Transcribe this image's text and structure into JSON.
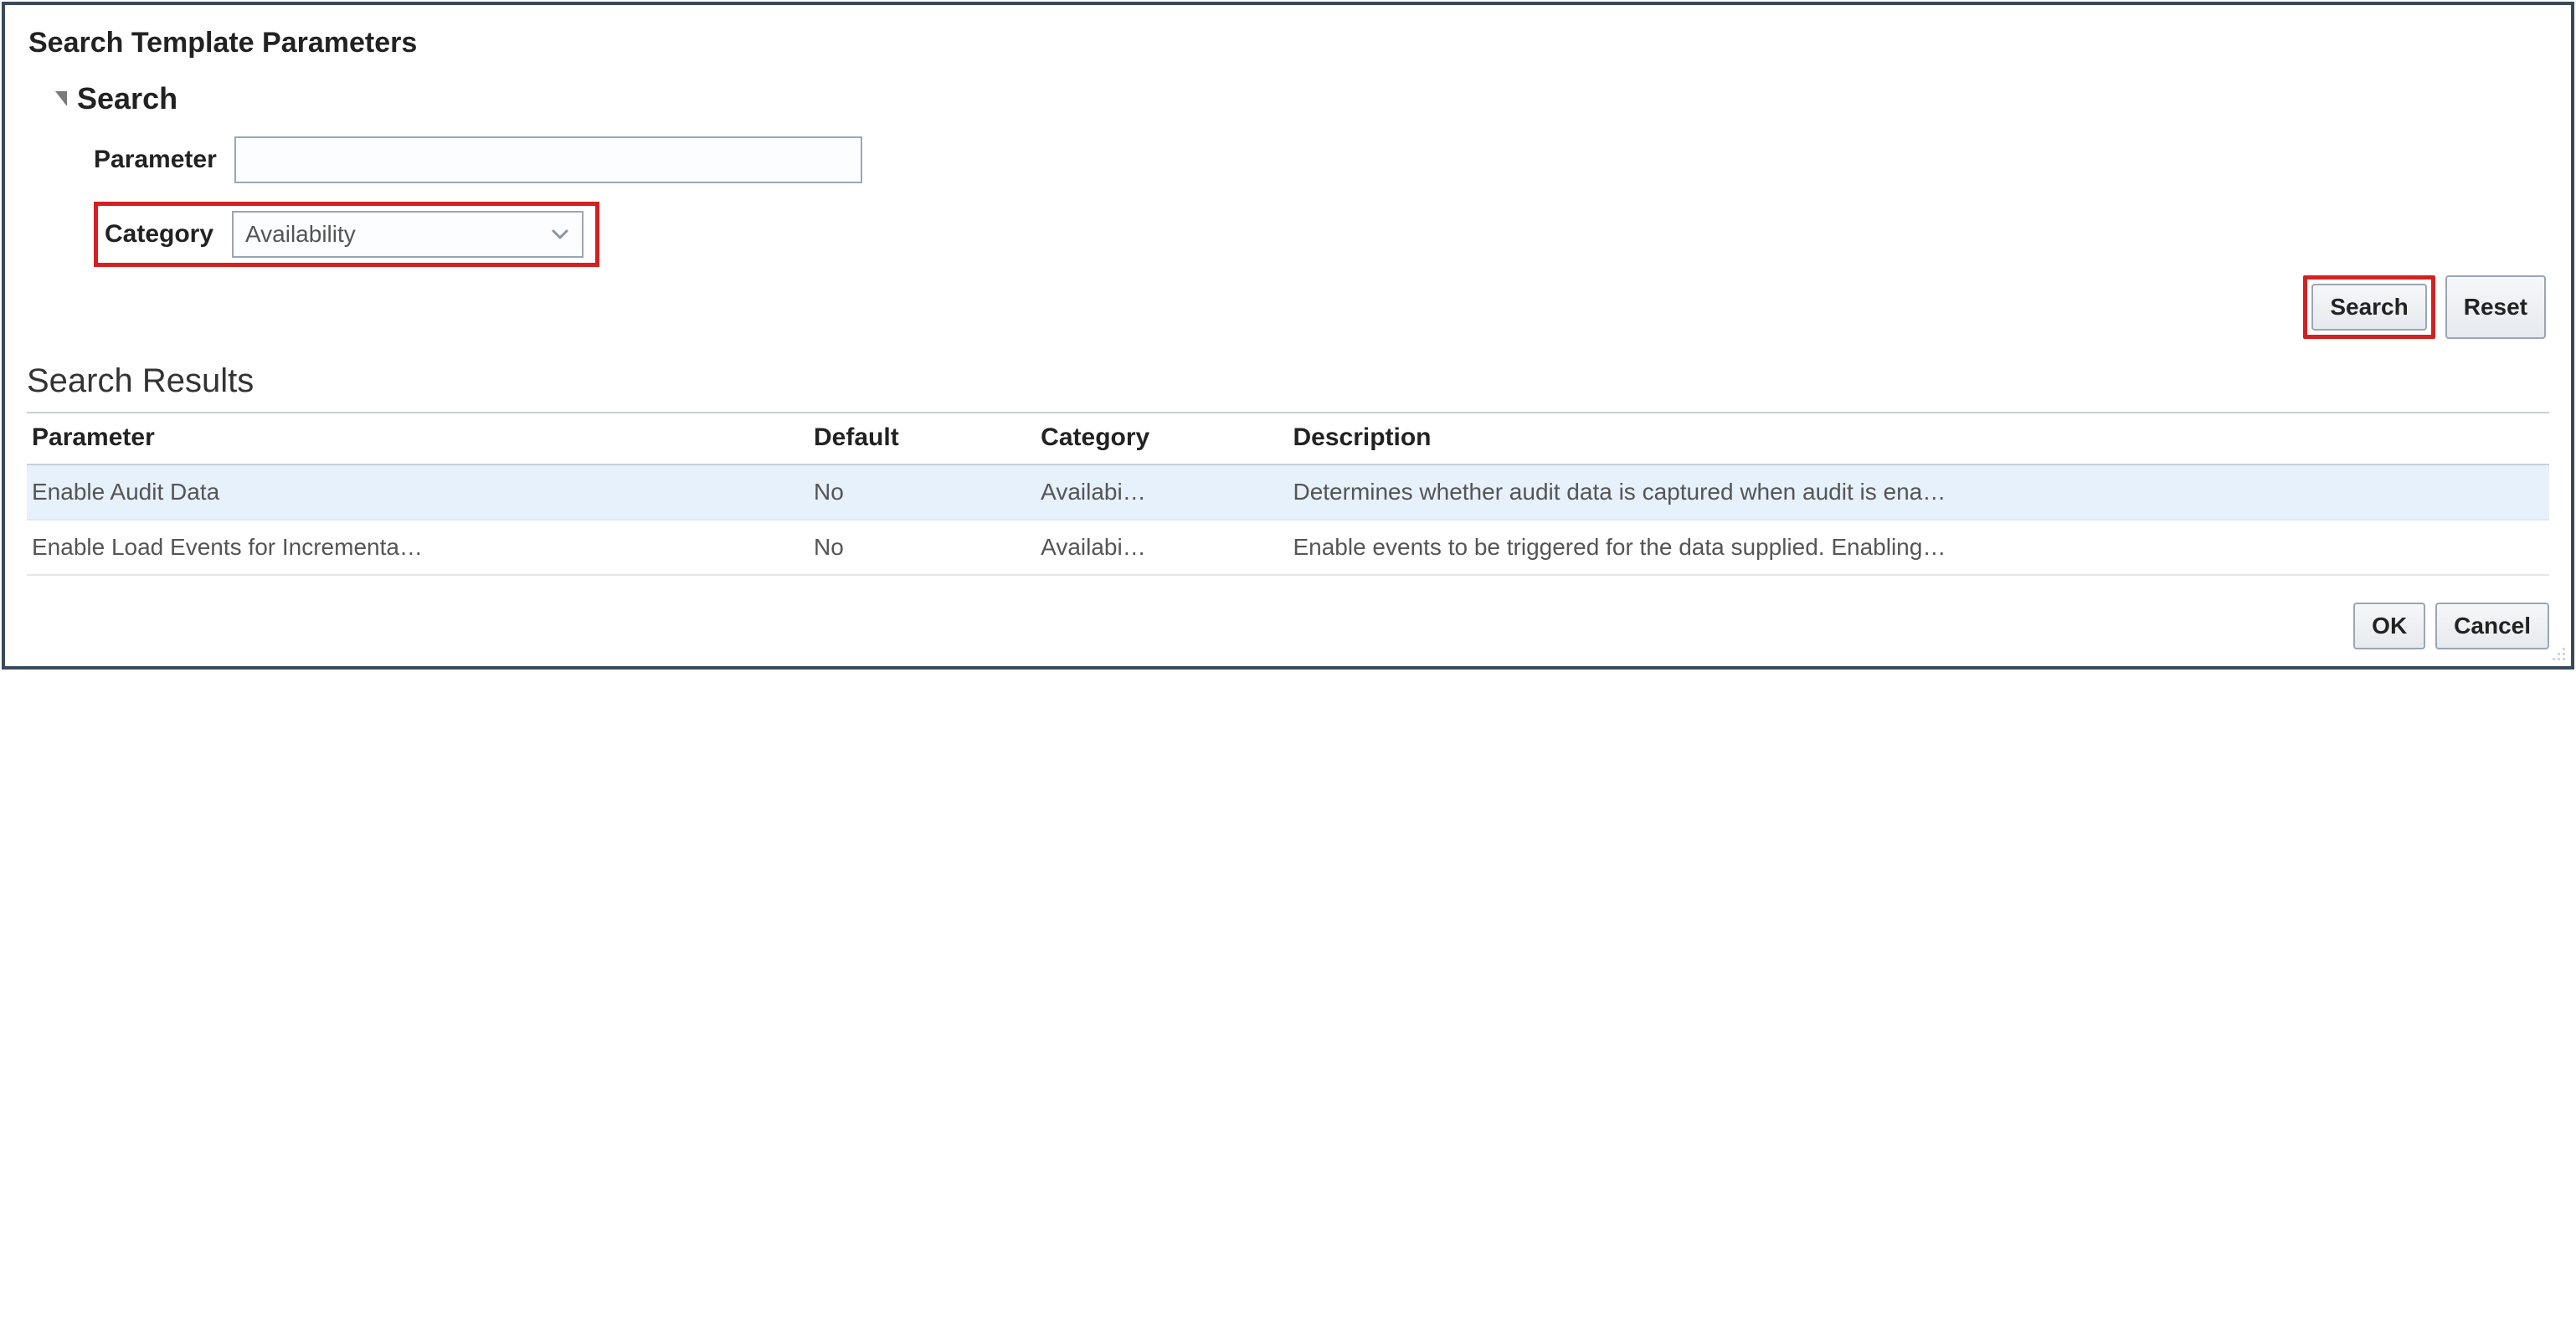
{
  "title": "Search Template Parameters",
  "search_section": {
    "heading": "Search",
    "parameter_label": "Parameter",
    "parameter_value": "",
    "category_label": "Category",
    "category_value": "Availability"
  },
  "buttons": {
    "search": "Search",
    "reset": "Reset",
    "ok": "OK",
    "cancel": "Cancel"
  },
  "results": {
    "heading": "Search Results",
    "columns": {
      "parameter": "Parameter",
      "default": "Default",
      "category": "Category",
      "description": "Description"
    },
    "rows": [
      {
        "parameter": "Enable Audit Data",
        "default": "No",
        "category": "Availabi…",
        "description": "Determines whether audit data is captured when audit is ena…",
        "selected": true
      },
      {
        "parameter": "Enable Load Events for Incrementa…",
        "default": "No",
        "category": "Availabi…",
        "description": "Enable events to be triggered for the data supplied. Enabling…",
        "selected": false
      }
    ]
  }
}
